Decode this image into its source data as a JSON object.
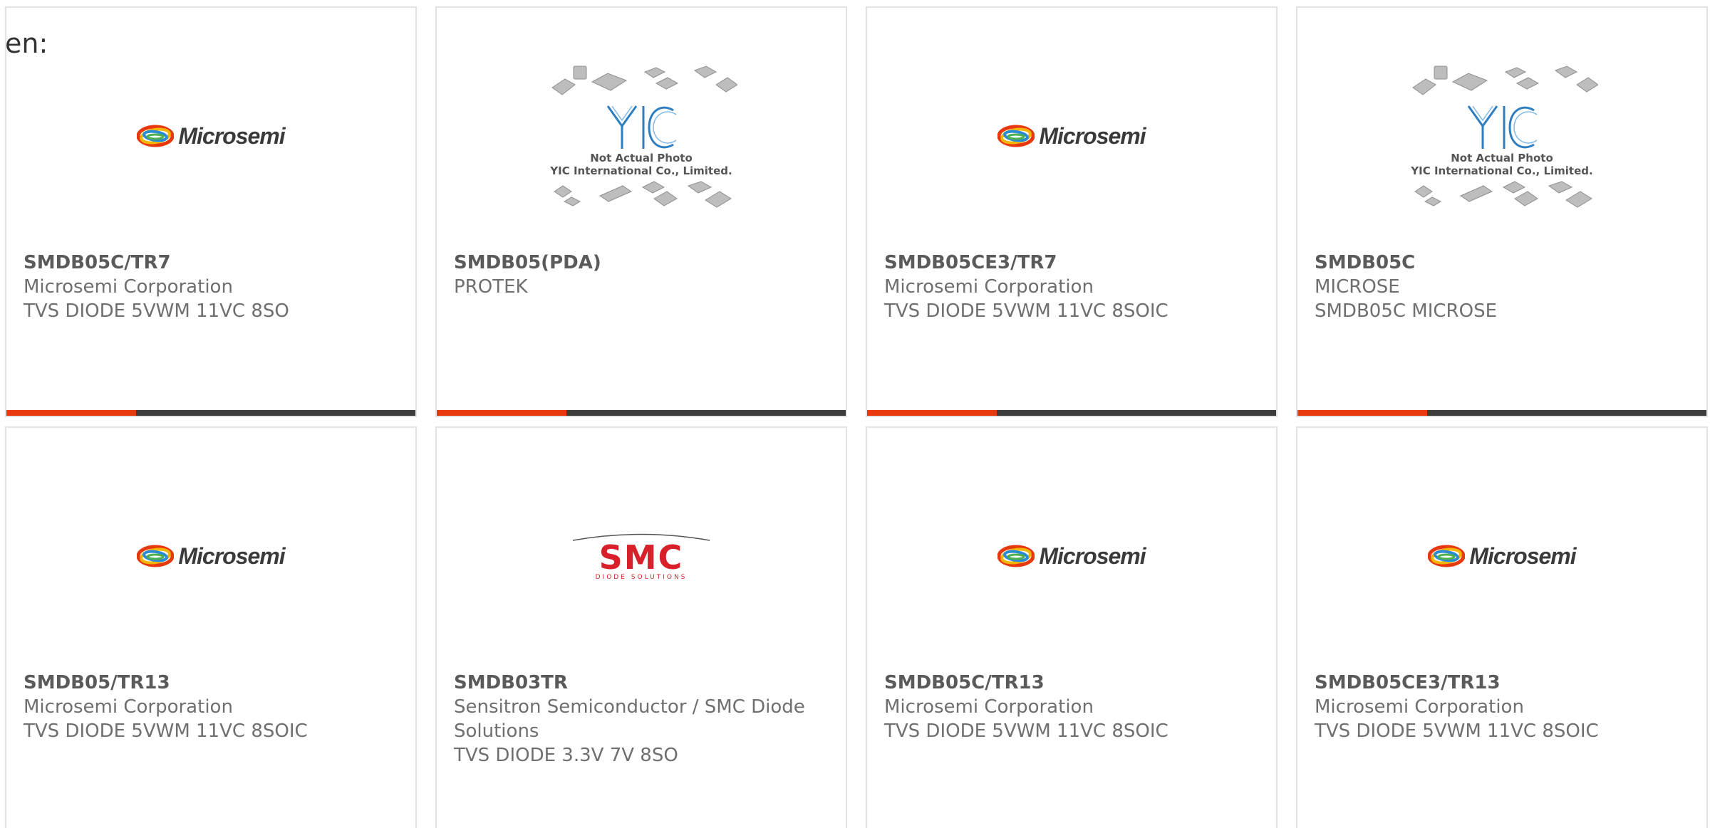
{
  "lang_label": "en:",
  "colors": {
    "accent_bar": "#e8380d",
    "dark_bar": "#3d3d3d",
    "card_border": "#e3e3e3",
    "microsemi_text": "#3a3a3a",
    "smc_red": "#d7202a"
  },
  "products": [
    {
      "part": "SMDB05C/TR7",
      "manufacturer": "Microsemi Corporation",
      "description": "TVS DIODE 5VWM 11VC 8SO",
      "logo": "microsemi-logo"
    },
    {
      "part": "SMDB05(PDA)",
      "manufacturer": "PROTEK",
      "description": "",
      "logo": "yic-placeholder-logo"
    },
    {
      "part": "SMDB05CE3/TR7",
      "manufacturer": "Microsemi Corporation",
      "description": "TVS DIODE 5VWM 11VC 8SOIC",
      "logo": "microsemi-logo"
    },
    {
      "part": "SMDB05C",
      "manufacturer": "MICROSE",
      "description": "SMDB05C MICROSE",
      "logo": "yic-placeholder-logo"
    },
    {
      "part": "SMDB05/TR13",
      "manufacturer": "Microsemi Corporation",
      "description": "TVS DIODE 5VWM 11VC 8SOIC",
      "logo": "microsemi-logo"
    },
    {
      "part": "SMDB03TR",
      "manufacturer": "Sensitron Semiconductor / SMC Diode Solutions",
      "description": "TVS DIODE 3.3V 7V 8SO",
      "logo": "smc-logo"
    },
    {
      "part": "SMDB05C/TR13",
      "manufacturer": "Microsemi Corporation",
      "description": "TVS DIODE 5VWM 11VC 8SOIC",
      "logo": "microsemi-logo"
    },
    {
      "part": "SMDB05CE3/TR13",
      "manufacturer": "Microsemi Corporation",
      "description": "TVS DIODE 5VWM 11VC 8SOIC",
      "logo": "microsemi-logo"
    }
  ],
  "logos": {
    "microsemi": {
      "text": "Microsemi"
    },
    "yic": {
      "mark": "YIC",
      "caption_line1": "Not Actual Photo",
      "caption_line2": "YIC International Co., Limited."
    },
    "smc": {
      "mark": "SMC",
      "sub": "DIODE SOLUTIONS"
    }
  }
}
